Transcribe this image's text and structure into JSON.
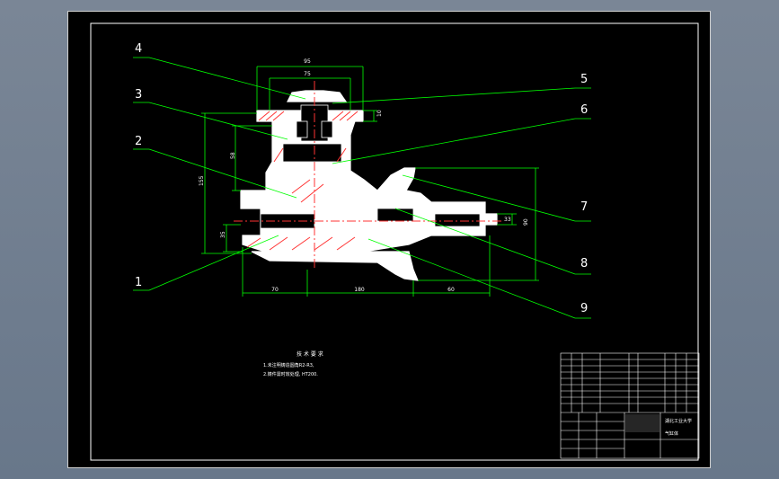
{
  "part_labels": [
    "4",
    "3",
    "2",
    "1",
    "5",
    "6",
    "7",
    "8",
    "9"
  ],
  "dimensions": {
    "top_outer": "95",
    "top_inner": "75",
    "right_flange": "10",
    "height_total": "155",
    "height_mid": "58",
    "left_hub": "35",
    "shaft_small": "33",
    "right_height": "90",
    "bottom_left": "70",
    "bottom_mid": "180",
    "bottom_right": "60"
  },
  "notes": {
    "title": "技 术 要 求",
    "line1": "1.未注明铸造圆角R2-R3,",
    "line2": "2.铸件需时效处理, HT200."
  },
  "title_block": {
    "school": "湖北工业大学",
    "drawing_name": "气缸体"
  },
  "colors": {
    "sheet": "#000000",
    "outline": "#ffffff",
    "leader": "#00ff00",
    "centerline": "#ff0000",
    "hatch": "#ff3333",
    "text": "#ffffff"
  }
}
